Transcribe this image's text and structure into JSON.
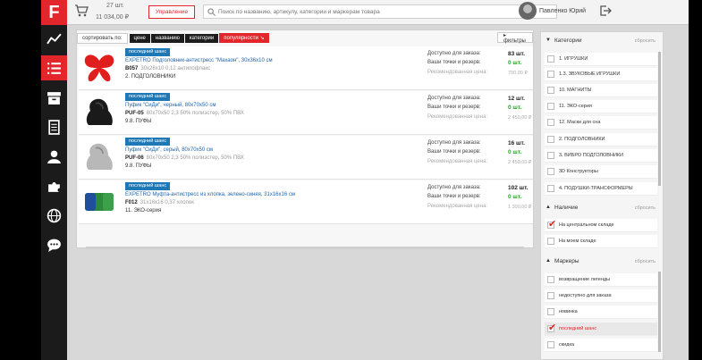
{
  "header": {
    "logo": "F",
    "cart_count": "27 шт.",
    "cart_sum": "11 034,00 ₽",
    "management_label": "Управление",
    "search_placeholder": "Поиск по названию, артикулу, категории и маркерам товара",
    "user_name": "Павленко Юрий"
  },
  "sidebar": {
    "icons": [
      "chart-line-icon",
      "list-icon",
      "box-icon",
      "document-icon",
      "user-icon",
      "puzzle-icon",
      "globe-icon",
      "chat-icon"
    ],
    "active_index": 1,
    "accent": "#e3262b"
  },
  "sort": {
    "label": "сортировать по:",
    "options": [
      "цене",
      "названию",
      "категории",
      "популярности ↘"
    ],
    "active": "популярности ↘",
    "filters_label": "▸ фильтры"
  },
  "products": [
    {
      "tag": "последний шанс",
      "name": "EXPETRO Подголовник-антистресс \"Махаон\", 30х36х10 см",
      "sku": "B057",
      "specs": "30х26х10 0,12 антипофлакс",
      "category": "2. ПОДГОЛОВНИКИ",
      "label_available": "Доступно для заказа:",
      "label_stock": "Ваши точки и резерв:",
      "label_price": "Рекомендованная цена:",
      "available": "83 шт.",
      "stock": "0 шт.",
      "price": "700,00 ₽",
      "image": "butterfly-pillow"
    },
    {
      "tag": "последний шанс",
      "name": "Пуфик \"СиДи\", черный, 80х70х50 см",
      "sku": "PUF-05",
      "specs": "80х70х50 2,3 50% полиэстер, 50% ПВХ",
      "category": "9.8. ПУФЫ",
      "label_available": "Доступно для заказа:",
      "label_stock": "Ваши точки и резерв:",
      "label_price": "Рекомендованная цена:",
      "available": "12 шт.",
      "stock": "0 шт.",
      "price": "2 450,00 ₽",
      "image": "black-pouf"
    },
    {
      "tag": "последний шанс",
      "name": "Пуфик \"СиДи\", серый, 80х70х50 см",
      "sku": "PUF-06",
      "specs": "80х70х50 2,3 50% полиэстер, 50% ПВХ",
      "category": "9.8. ПУФЫ",
      "label_available": "Доступно для заказа:",
      "label_stock": "Ваши точки и резерв:",
      "label_price": "Рекомендованная цена:",
      "available": "16 шт.",
      "stock": "0 шт.",
      "price": "2 450,00 ₽",
      "image": "gray-pouf"
    },
    {
      "tag": "последний шанс",
      "name": "EXPETRO Муфта-антистресс из хлопка, зелено-синяя, 31х16х16 см",
      "sku": "F012",
      "specs": "31х16х16 0,37 хлопок",
      "category": "11. ЭКО-серия",
      "label_available": "Доступно для заказа:",
      "label_stock": "Ваши точки и резерв:",
      "label_price": "Рекомендованная цена:",
      "available": "102 шт.",
      "stock": "0 шт.",
      "price": "1 300,00 ₽",
      "image": "green-muff"
    }
  ],
  "filters": {
    "categories": {
      "title": "Категории",
      "reset": "сбросить",
      "items": [
        "1. ИГРУШКИ",
        "1.3. ЗВУКОВЫЕ ИГРУШКИ",
        "10. МАГНИТЫ",
        "11. ЭКО-серия",
        "12. Маски для сна",
        "2. ПОДГОЛОВНИКИ",
        "3. ВИБРО ПОДГОЛОВНИКИ",
        "3D Конструкторы",
        "4. ПОДУШКИ-ТРАНСФОРМЕРЫ"
      ]
    },
    "availability": {
      "title": "Наличие",
      "reset": "сбросить",
      "items": [
        {
          "label": "На центральном складе",
          "checked": true
        },
        {
          "label": "На моем складе",
          "checked": false
        }
      ]
    },
    "markers": {
      "title": "Маркеры",
      "reset": "сбросить",
      "items": [
        {
          "label": "возвращение легенды",
          "checked": false
        },
        {
          "label": "недоступно для заказа",
          "checked": false
        },
        {
          "label": "новинка",
          "checked": false
        },
        {
          "label": "последний шанс",
          "checked": true
        },
        {
          "label": "скидка",
          "checked": false
        }
      ]
    }
  }
}
